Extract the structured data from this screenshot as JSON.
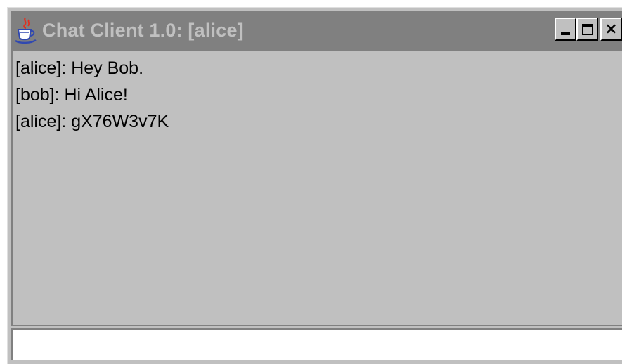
{
  "window": {
    "title": "Chat Client 1.0: [alice]",
    "app_icon": "java-coffee-cup-icon",
    "controls": {
      "minimize_icon": "minimize-icon",
      "maximize_icon": "maximize-icon",
      "close_icon": "close-icon",
      "close_glyph": "×"
    }
  },
  "chat": {
    "messages": [
      "[alice]: Hey Bob.",
      "[bob]: Hi Alice!",
      "[alice]: gX76W3v7K"
    ]
  },
  "input": {
    "value": "",
    "placeholder": ""
  },
  "colors": {
    "titlebar": "#808080",
    "title_text": "#c0c0c0",
    "window_bg": "#c0c0c0",
    "input_bg": "#ffffff"
  }
}
